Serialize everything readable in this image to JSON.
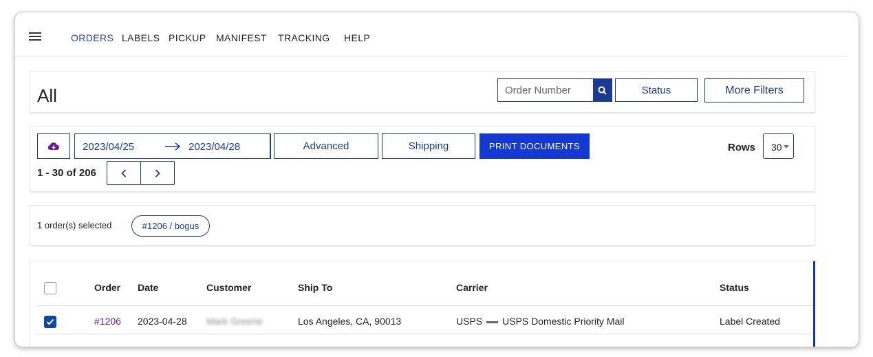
{
  "nav": {
    "items": [
      "ORDERS",
      "LABELS",
      "PICKUP",
      "MANIFEST",
      "TRACKING",
      "HELP"
    ]
  },
  "header": {
    "title": "All",
    "search_placeholder": "Order Number",
    "status_label": "Status",
    "more_filters_label": "More Filters"
  },
  "toolbar": {
    "date_from": "2023/04/25",
    "date_to": "2023/04/28",
    "advanced_label": "Advanced",
    "shipping_label": "Shipping",
    "print_label": "PRINT DOCUMENTS",
    "rows_label": "Rows",
    "rows_value": "30",
    "page_count": "1 - 30 of 206"
  },
  "selection": {
    "text": "1 order(s) selected",
    "chip": "#1206 / bogus"
  },
  "table": {
    "columns": [
      "Order",
      "Date",
      "Customer",
      "Ship To",
      "Carrier",
      "Status"
    ],
    "rows": [
      {
        "selected": true,
        "order": "#1206",
        "date": "2023-04-28",
        "customer": "Mark Greene",
        "ship_to": "Los Angeles, CA, 90013",
        "carrier": "USPS",
        "service": "USPS Domestic Priority Mail",
        "status": "Label Created"
      }
    ]
  },
  "colors": {
    "accent": "#1a3a8e",
    "primary_button": "#1339d1",
    "active_nav": "#2a3eb1",
    "order_link": "#6a1b9a"
  }
}
